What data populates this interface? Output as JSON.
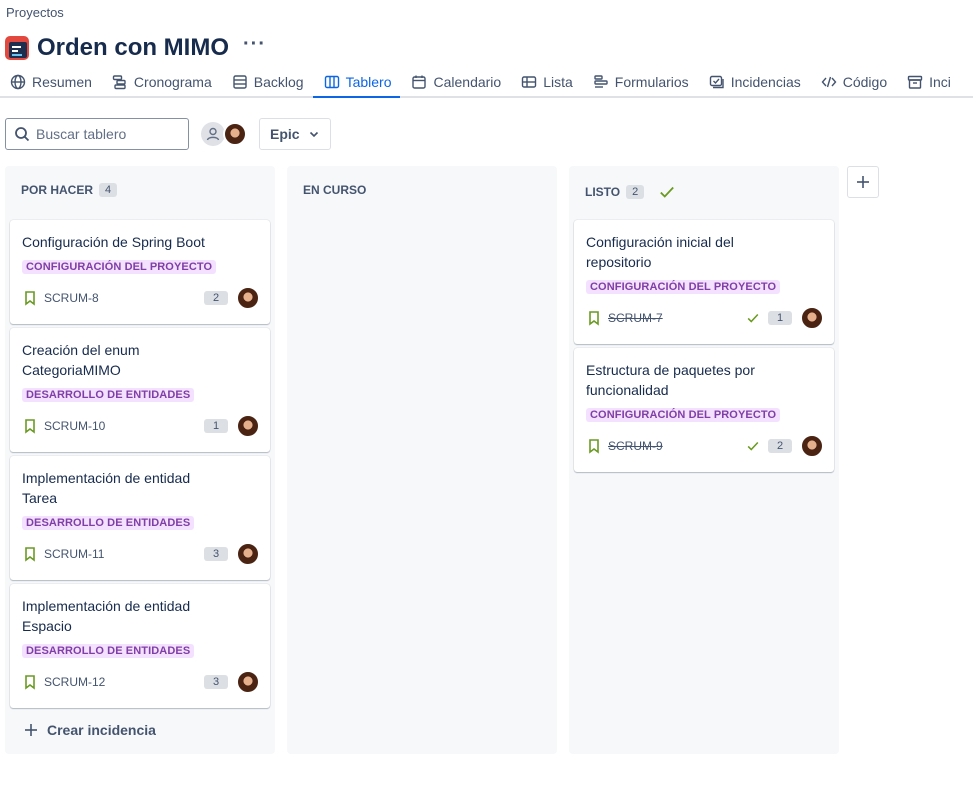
{
  "breadcrumb": "Proyectos",
  "project": {
    "title": "Orden con MIMO",
    "more": "···"
  },
  "tabs": [
    {
      "label": "Resumen",
      "icon": "globe-icon"
    },
    {
      "label": "Cronograma",
      "icon": "timeline-icon"
    },
    {
      "label": "Backlog",
      "icon": "backlog-icon"
    },
    {
      "label": "Tablero",
      "icon": "board-icon",
      "active": true
    },
    {
      "label": "Calendario",
      "icon": "calendar-icon"
    },
    {
      "label": "Lista",
      "icon": "list-icon"
    },
    {
      "label": "Formularios",
      "icon": "forms-icon"
    },
    {
      "label": "Incidencias",
      "icon": "issues-icon"
    },
    {
      "label": "Código",
      "icon": "code-icon"
    },
    {
      "label": "Inci",
      "icon": "archive-icon"
    }
  ],
  "toolbar": {
    "search_placeholder": "Buscar tablero",
    "epic_label": "Epic"
  },
  "columns": [
    {
      "name": "POR HACER",
      "count": "4",
      "cards": [
        {
          "title": "Configuración de Spring Boot",
          "label": "CONFIGURACIÓN DEL PROYECTO",
          "key": "SCRUM-8",
          "points": "2"
        },
        {
          "title": "Creación del enum CategoriaMIMO",
          "label": "DESARROLLO DE ENTIDADES",
          "key": "SCRUM-10",
          "points": "1"
        },
        {
          "title": "Implementación de entidad Tarea",
          "label": "DESARROLLO DE ENTIDADES",
          "key": "SCRUM-11",
          "points": "3"
        },
        {
          "title": "Implementación de entidad Espacio",
          "label": "DESARROLLO DE ENTIDADES",
          "key": "SCRUM-12",
          "points": "3"
        }
      ],
      "create_label": "Crear incidencia"
    },
    {
      "name": "EN CURSO",
      "cards": []
    },
    {
      "name": "LISTO",
      "count": "2",
      "cards": [
        {
          "title": "Configuración inicial del repositorio",
          "label": "CONFIGURACIÓN DEL PROYECTO",
          "key": "SCRUM-7",
          "points": "1",
          "done": true
        },
        {
          "title": "Estructura de paquetes por funcionalidad",
          "label": "CONFIGURACIÓN DEL PROYECTO",
          "key": "SCRUM-9",
          "points": "2",
          "done": true
        }
      ]
    }
  ],
  "colors": {
    "accent": "#0c66e4",
    "label_text": "#803fa5",
    "label_bg": "#f3e1ff",
    "story_icon": "#6a9a23",
    "done_check": "#6a9a23"
  }
}
